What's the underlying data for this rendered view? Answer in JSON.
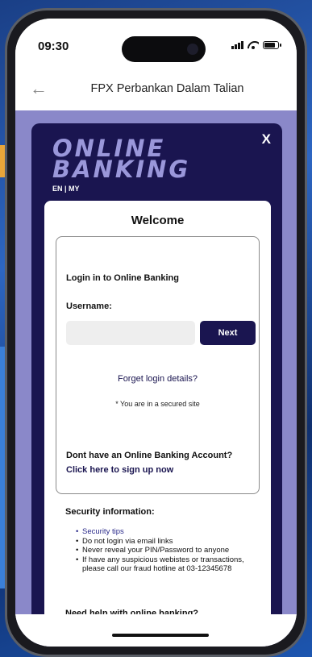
{
  "status_bar": {
    "time": "09:30",
    "icons": [
      "signal-icon",
      "wifi-icon",
      "battery-icon"
    ]
  },
  "header": {
    "back_icon": "←",
    "title": "FPX Perbankan Dalam Talian"
  },
  "panel": {
    "logo_line1": "ONLINE",
    "logo_line2": "BANKING",
    "lang_en": "EN",
    "lang_sep": " | ",
    "lang_my": "MY",
    "close_icon": "X"
  },
  "card": {
    "welcome": "Welcome",
    "login_heading": "Login in to Online Banking",
    "username_label": "Username:",
    "username_value": "",
    "next_label": "Next",
    "forget_link": "Forget login details?",
    "secured_note": "* You are in a secured site",
    "no_account": "Dont have an Online Banking Account?",
    "signup_link": "Click here to sign up now"
  },
  "security": {
    "heading": "Security information:",
    "items": [
      "Security tips",
      "Do not login via email links",
      "Never reveal your PIN/Password to anyone",
      "If have any suspicious webistes or transactions, please call our fraud hotline at 03-12345678"
    ],
    "help_heading": "Need help with online banking?"
  },
  "colors": {
    "panel_bg": "#1a1550",
    "content_bg": "#8a88c9",
    "logo_color": "#9a97da",
    "link_color": "#1a1550"
  }
}
